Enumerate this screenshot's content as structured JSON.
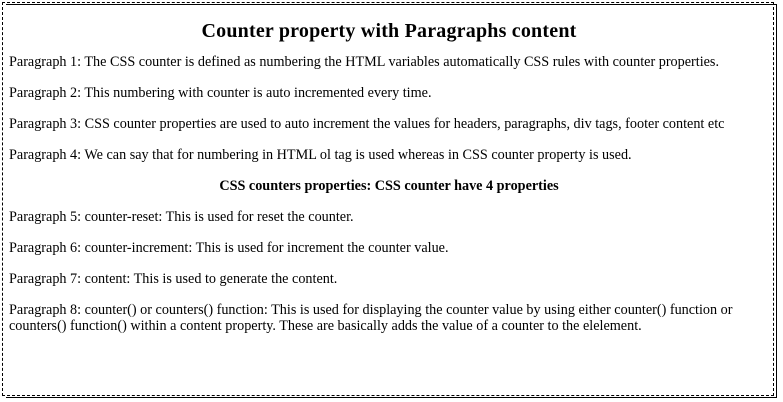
{
  "page": {
    "title": "Counter property with Paragraphs content",
    "paragraphs": [
      "Paragraph 1: The CSS counter is defined as numbering the HTML variables automatically CSS rules with counter properties.",
      "Paragraph 2: This numbering with counter is auto incremented every time.",
      "Paragraph 3: CSS counter properties are used to auto increment the values for headers, paragraphs, div tags, footer content etc",
      "Paragraph 4: We can say that for numbering in HTML ol tag is used whereas in CSS counter property is used."
    ],
    "subheading": "CSS counters properties: CSS counter have 4 properties",
    "paragraphs_after": [
      "Paragraph 5: counter-reset: This is used for reset the counter.",
      "Paragraph 6: counter-increment: This is used for increment the counter value.",
      "Paragraph 7: content: This is used to generate the content.",
      "Paragraph 8: counter() or counters() function: This is used for displaying the counter value by using either counter() function or counters() function() within a content property. These are basically adds the value of a counter to the elelement."
    ]
  }
}
